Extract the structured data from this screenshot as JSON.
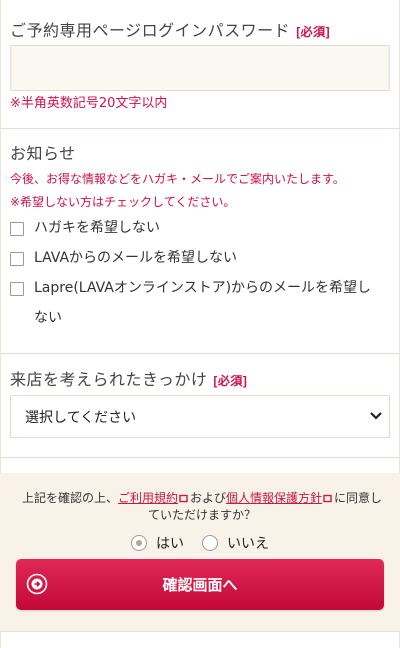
{
  "password": {
    "label": "ご予約専用ページログインパスワード",
    "required": "[必須]",
    "value": "",
    "placeholder": "",
    "note": "※半角英数記号20文字以内"
  },
  "notice": {
    "label": "お知らせ",
    "desc1": "今後、お得な情報などをハガキ・メールでご案内いたします。",
    "desc2": "※希望しない方はチェックしてください。",
    "options": [
      {
        "label": "ハガキを希望しない",
        "checked": false
      },
      {
        "label": "LAVAからのメールを希望しない",
        "checked": false
      },
      {
        "label": "Lapre(LAVAオンラインストア)からのメールを希望しない",
        "checked": false
      }
    ]
  },
  "visit": {
    "label": "来店を考えられたきっかけ",
    "required": "[必須]",
    "selected": "選択してください"
  },
  "agreement": {
    "prefix": "上記を確認の上、",
    "terms_link": "ご利用規約",
    "and": "および",
    "privacy_link": "個人情報保護方針",
    "suffix": "に同意していただけますか？",
    "yes": "はい",
    "no": "いいえ",
    "selected": "yes"
  },
  "confirm_button": "確認画面へ",
  "colors": {
    "accent": "#d0114a",
    "button": "#d2093f",
    "band": "#f8f2e9"
  }
}
